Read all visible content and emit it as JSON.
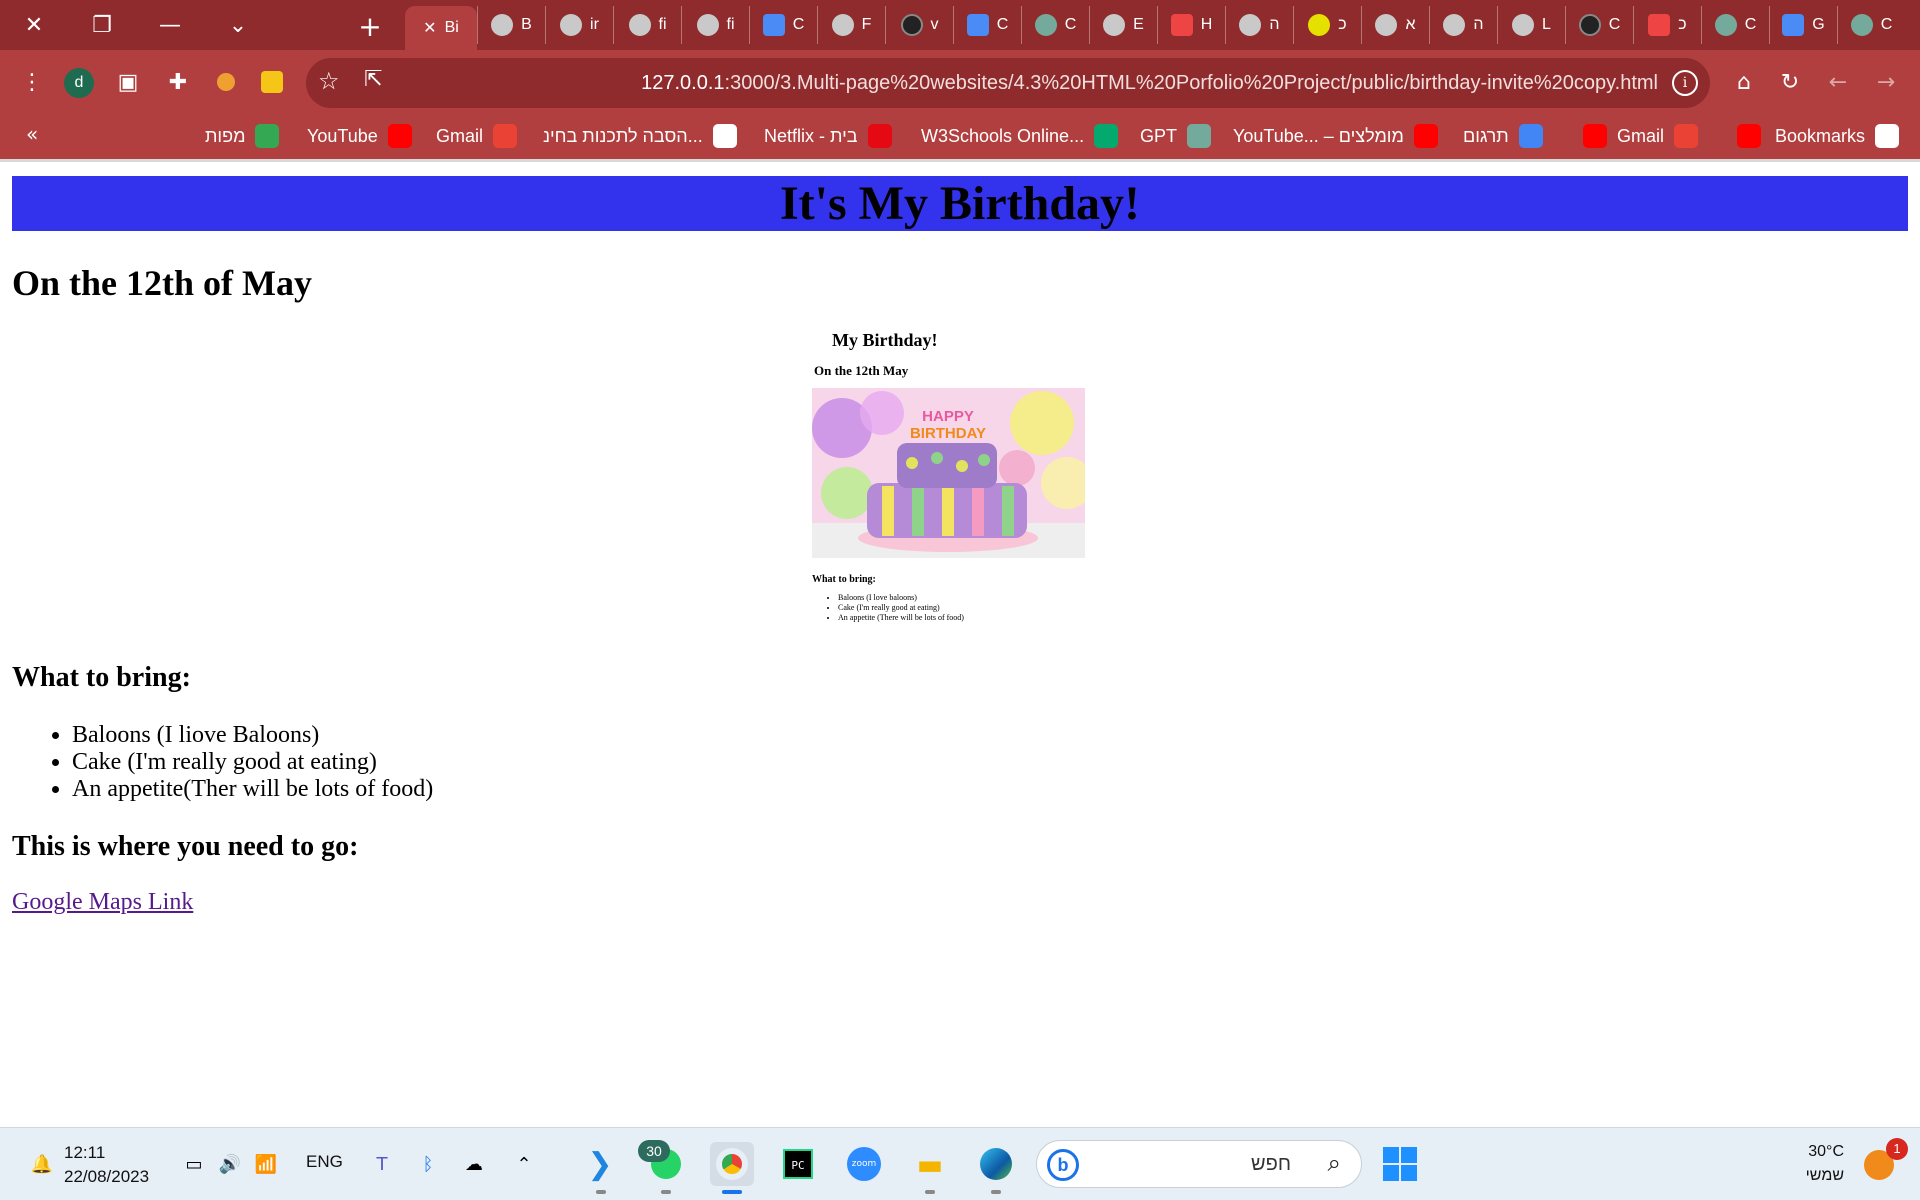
{
  "browser": {
    "tabs": [
      {
        "label": "Bi",
        "icon": "close-icon",
        "active": true
      },
      {
        "label": "B",
        "icon": "globe-icon"
      },
      {
        "label": "ir",
        "icon": "globe-icon"
      },
      {
        "label": "fi",
        "icon": "globe-icon"
      },
      {
        "label": "fi",
        "icon": "globe-icon"
      },
      {
        "label": "C",
        "icon": "translate-icon"
      },
      {
        "label": "F",
        "icon": "globe-icon"
      },
      {
        "label": "v",
        "icon": "dark-icon"
      },
      {
        "label": "C",
        "icon": "translate-icon"
      },
      {
        "label": "C",
        "icon": "chatgpt-icon"
      },
      {
        "label": "E",
        "icon": "globe-icon"
      },
      {
        "label": "H",
        "icon": "red-icon"
      },
      {
        "label": "ה",
        "icon": "list-icon"
      },
      {
        "label": "כ",
        "icon": "yellow-icon"
      },
      {
        "label": "א",
        "icon": "sharepoint-icon"
      },
      {
        "label": "ה",
        "icon": "gear-icon"
      },
      {
        "label": "L",
        "icon": "vuetify-icon"
      },
      {
        "label": "C",
        "icon": "dark-icon"
      },
      {
        "label": "כ",
        "icon": "gmail-icon"
      },
      {
        "label": "C",
        "icon": "chatgpt-icon"
      },
      {
        "label": "G",
        "icon": "translate-icon"
      },
      {
        "label": "C",
        "icon": "chatgpt-icon"
      }
    ],
    "avatar_letter": "d",
    "url_host": "127.0.0.1",
    "url_rest": ":3000/3.Multi-page%20websites/4.3%20HTML%20Porfolio%20Project/public/birthday-invite%20copy.html",
    "bookmarks": [
      {
        "label": "מפות",
        "color": "#34a853"
      },
      {
        "label": "YouTube",
        "color": "#ff0000"
      },
      {
        "label": "Gmail",
        "color": "#ea4335"
      },
      {
        "label": "הסבה לתכנות בחינ...",
        "color": "#ffffff"
      },
      {
        "label": "Netflix - בית",
        "color": "#e50914"
      },
      {
        "label": "W3Schools Online...",
        "color": "#04aa6d"
      },
      {
        "label": "GPT",
        "color": "#74aa9c"
      },
      {
        "label": "YouTube... – מומלצים",
        "color": "#ff0000"
      },
      {
        "label": "תרגום",
        "color": "#4285f4"
      },
      {
        "label": "",
        "color": "#ff0000"
      },
      {
        "label": "Gmail",
        "color": "#ea4335"
      },
      {
        "label": "",
        "color": "#ff0000"
      },
      {
        "label": "Bookmarks",
        "color": "#ffffff"
      }
    ]
  },
  "page": {
    "banner_title": "It's My Birthday!",
    "date_heading": "On the 12th of May",
    "thumbnail": {
      "title": "My Birthday!",
      "date": "On the 12th May",
      "cake_text": "HAPPY BIRTHDAY",
      "bring_heading": "What to bring:",
      "items": [
        "Baloons (I love baloons)",
        "Cake (I'm really good at eating)",
        "An appetite (There will be lots of food)"
      ]
    },
    "bring_heading": "What to bring:",
    "bring_items": [
      "Baloons (I liove Baloons)",
      "Cake (I'm really good at eating)",
      "An appetite(Ther will be lots of food)"
    ],
    "go_heading": "This is where you need to go:",
    "map_link": "Google Maps Link"
  },
  "taskbar": {
    "time": "12:11",
    "date": "22/08/2023",
    "language": "ENG",
    "whatsapp_badge": "30",
    "search_placeholder": "חפש",
    "temperature": "30°C",
    "weather_label": "שמשי",
    "notification_count": "1"
  }
}
